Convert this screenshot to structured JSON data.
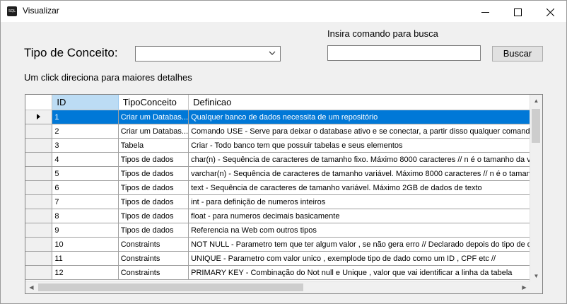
{
  "window": {
    "title": "Visualizar",
    "icon_text": "SQL"
  },
  "form": {
    "tipo_label": "Tipo de Conceito:",
    "tipo_value": "",
    "search_label": "Insira comando para busca",
    "search_value": "",
    "search_button": "Buscar",
    "hint": "Um click direciona para maiores detalhes"
  },
  "grid": {
    "columns": [
      "ID",
      "TipoConceito",
      "Definicao"
    ],
    "selected_row": 0,
    "rows": [
      [
        "1",
        "Criar um Databas...",
        "Qualquer banco de dados necessita de um repositório"
      ],
      [
        "2",
        "Criar um Databas...",
        "Comando USE - Serve para deixar o database ativo e se conectar, a partir disso qualquer comando e"
      ],
      [
        "3",
        "Tabela",
        "Criar - Todo banco tem que possuir tabelas e seus elementos"
      ],
      [
        "4",
        "Tipos de dados",
        "char(n) -  Sequência de caracteres de tamanho fixo. Máximo 8000 caracteres // n é o tamanho da v"
      ],
      [
        "5",
        "Tipos de dados",
        "varchar(n) - Sequência de caracteres de tamanho variável. Máximo 8000 caracteres  // n é o taman"
      ],
      [
        "6",
        "Tipos de dados",
        "text - Sequência de caracteres de tamanho variável. Máximo 2GB de dados de texto"
      ],
      [
        "7",
        "Tipos de dados",
        "int - para definição de numeros inteiros"
      ],
      [
        "8",
        "Tipos de dados",
        "float - para numeros decimais basicamente"
      ],
      [
        "9",
        "Tipos de dados",
        "Referencia na Web com outros tipos"
      ],
      [
        "10",
        "Constraints",
        "NOT NULL  - Parametro tem que ter algum valor , se não gera erro // Declarado depois do tipo de da"
      ],
      [
        "11",
        "Constraints",
        "UNIQUE - Parametro com valor unico , exemplode tipo de dado como um ID , CPF  etc //"
      ],
      [
        "12",
        "Constraints",
        "PRIMARY KEY - Combinação do Not null e Unique , valor que vai identificar a linha da tabela"
      ]
    ]
  }
}
